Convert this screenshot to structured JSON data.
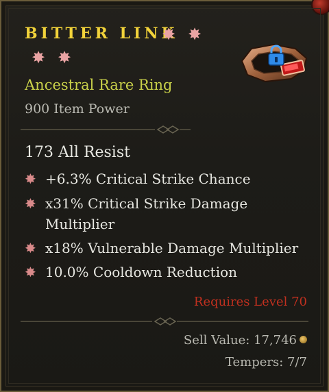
{
  "item": {
    "name": "BITTER LINK",
    "type": "Ancestral Rare Ring",
    "item_power": "900 Item Power",
    "base_stat": "173 All Resist",
    "affixes": [
      "+6.3% Critical Strike Chance",
      "x31% Critical Strike Damage Multiplier",
      "x18% Vulnerable Damage Multiplier",
      "10.0% Cooldown Reduction"
    ],
    "requirement": "Requires Level 70",
    "sell_value": "Sell Value: 17,746",
    "tempers": "Tempers: 7/7",
    "ancestral_marks": 4,
    "icons": {
      "item": "ring-icon",
      "lock": "lock-icon",
      "currency": "gold-coin-icon",
      "bullet": "affix-star-icon",
      "mark": "ancestral-star-icon"
    }
  },
  "colors": {
    "name": "#f2d33a",
    "type": "#c9d14a",
    "requirement": "#c0301f",
    "affix_bullet": "#d98a8a"
  }
}
